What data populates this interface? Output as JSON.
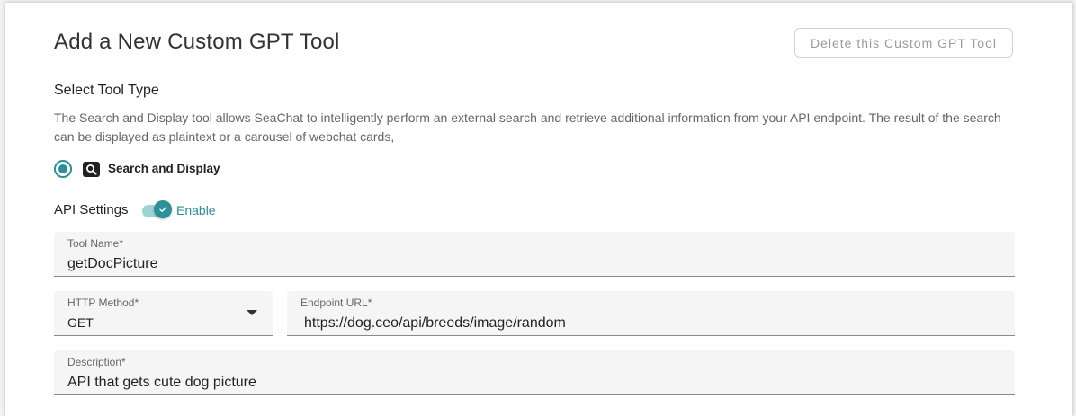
{
  "header": {
    "title": "Add a New Custom GPT Tool",
    "delete_button": "Delete this Custom GPT Tool"
  },
  "tool_type": {
    "section_label": "Select Tool Type",
    "description": "The Search and Display tool allows SeaChat to intelligently perform an external search and retrieve additional information from your API endpoint. The result of the search can be displayed as plaintext or a carousel of webchat cards,",
    "option_label": "Search and Display",
    "option_icon": "search-icon",
    "selected": true
  },
  "api_settings": {
    "label": "API Settings",
    "toggle_label": "Enable",
    "enabled": true
  },
  "form": {
    "tool_name": {
      "label": "Tool Name*",
      "value": "getDocPicture"
    },
    "http_method": {
      "label": "HTTP Method*",
      "value": "GET"
    },
    "endpoint_url": {
      "label": "Endpoint URL*",
      "value": "https://dog.ceo/api/breeds/image/random"
    },
    "description": {
      "label": "Description*",
      "value": "API that gets cute dog picture"
    }
  },
  "colors": {
    "accent": "#2d8f98",
    "toggle_track": "#9fd2d6"
  }
}
